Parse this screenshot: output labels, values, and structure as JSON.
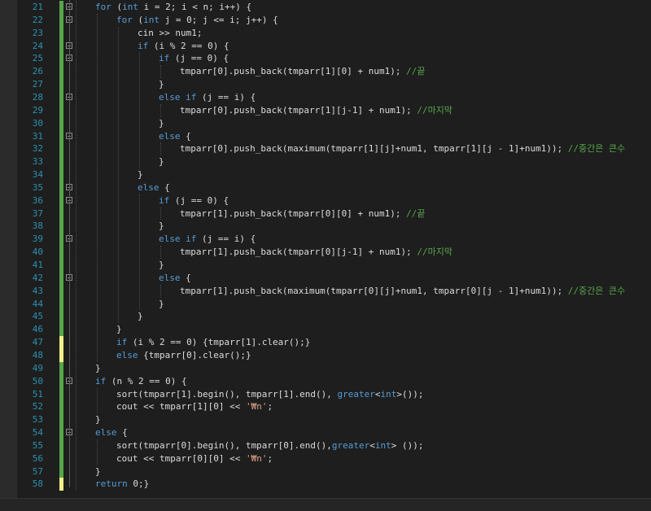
{
  "colors": {
    "background": "#1e1e1e",
    "line_number": "#2b91af",
    "keyword": "#569cd6",
    "comment": "#57a64a",
    "string": "#d69d85",
    "text": "#dcdcdc",
    "saved_change": "#57a64a",
    "unsaved_change": "#efef88"
  },
  "lines": [
    {
      "n": "21",
      "change": "saved",
      "fold": true,
      "indent": 1,
      "tokens": [
        {
          "t": "kw",
          "s": "for"
        },
        {
          "t": "tx",
          "s": " ("
        },
        {
          "t": "kw",
          "s": "int"
        },
        {
          "t": "tx",
          "s": " i = 2; i < n; i++) {"
        }
      ]
    },
    {
      "n": "22",
      "change": "saved",
      "fold": true,
      "indent": 2,
      "tokens": [
        {
          "t": "kw",
          "s": "for"
        },
        {
          "t": "tx",
          "s": " ("
        },
        {
          "t": "kw",
          "s": "int"
        },
        {
          "t": "tx",
          "s": " j = 0; j <= i; j++) {"
        }
      ]
    },
    {
      "n": "23",
      "change": "saved",
      "fold": false,
      "indent": 3,
      "tokens": [
        {
          "t": "tx",
          "s": "cin >> num1;"
        }
      ]
    },
    {
      "n": "24",
      "change": "saved",
      "fold": true,
      "indent": 3,
      "tokens": [
        {
          "t": "kw",
          "s": "if"
        },
        {
          "t": "tx",
          "s": " (i % 2 == 0) {"
        }
      ]
    },
    {
      "n": "25",
      "change": "saved",
      "fold": true,
      "indent": 4,
      "tokens": [
        {
          "t": "kw",
          "s": "if"
        },
        {
          "t": "tx",
          "s": " (j == 0) {"
        }
      ]
    },
    {
      "n": "26",
      "change": "saved",
      "fold": false,
      "indent": 5,
      "tokens": [
        {
          "t": "tx",
          "s": "tmparr[0].push_back(tmparr[1][0] + num1); "
        },
        {
          "t": "cm",
          "s": "//끝"
        }
      ]
    },
    {
      "n": "27",
      "change": "saved",
      "fold": false,
      "indent": 4,
      "tokens": [
        {
          "t": "tx",
          "s": "}"
        }
      ]
    },
    {
      "n": "28",
      "change": "saved",
      "fold": true,
      "indent": 4,
      "tokens": [
        {
          "t": "kw",
          "s": "else"
        },
        {
          "t": "tx",
          "s": " "
        },
        {
          "t": "kw",
          "s": "if"
        },
        {
          "t": "tx",
          "s": " (j == i) {"
        }
      ]
    },
    {
      "n": "29",
      "change": "saved",
      "fold": false,
      "indent": 5,
      "tokens": [
        {
          "t": "tx",
          "s": "tmparr[0].push_back(tmparr[1][j-1] + num1); "
        },
        {
          "t": "cm",
          "s": "//마지막"
        }
      ]
    },
    {
      "n": "30",
      "change": "saved",
      "fold": false,
      "indent": 4,
      "tokens": [
        {
          "t": "tx",
          "s": "}"
        }
      ]
    },
    {
      "n": "31",
      "change": "saved",
      "fold": true,
      "indent": 4,
      "tokens": [
        {
          "t": "kw",
          "s": "else"
        },
        {
          "t": "tx",
          "s": " {"
        }
      ]
    },
    {
      "n": "32",
      "change": "saved",
      "fold": false,
      "indent": 5,
      "tokens": [
        {
          "t": "tx",
          "s": "tmparr[0].push_back(maximum(tmparr[1][j]+num1, tmparr[1][j - 1]+num1)); "
        },
        {
          "t": "cm",
          "s": "//중간은 큰수"
        }
      ]
    },
    {
      "n": "33",
      "change": "saved",
      "fold": false,
      "indent": 4,
      "tokens": [
        {
          "t": "tx",
          "s": "}"
        }
      ]
    },
    {
      "n": "34",
      "change": "saved",
      "fold": false,
      "indent": 3,
      "tokens": [
        {
          "t": "tx",
          "s": "}"
        }
      ]
    },
    {
      "n": "35",
      "change": "saved",
      "fold": true,
      "indent": 3,
      "tokens": [
        {
          "t": "kw",
          "s": "else"
        },
        {
          "t": "tx",
          "s": " {"
        }
      ]
    },
    {
      "n": "36",
      "change": "saved",
      "fold": true,
      "indent": 4,
      "tokens": [
        {
          "t": "kw",
          "s": "if"
        },
        {
          "t": "tx",
          "s": " (j == 0) {"
        }
      ]
    },
    {
      "n": "37",
      "change": "saved",
      "fold": false,
      "indent": 5,
      "tokens": [
        {
          "t": "tx",
          "s": "tmparr[1].push_back(tmparr[0][0] + num1); "
        },
        {
          "t": "cm",
          "s": "//끝"
        }
      ]
    },
    {
      "n": "38",
      "change": "saved",
      "fold": false,
      "indent": 4,
      "tokens": [
        {
          "t": "tx",
          "s": "}"
        }
      ]
    },
    {
      "n": "39",
      "change": "saved",
      "fold": true,
      "indent": 4,
      "tokens": [
        {
          "t": "kw",
          "s": "else"
        },
        {
          "t": "tx",
          "s": " "
        },
        {
          "t": "kw",
          "s": "if"
        },
        {
          "t": "tx",
          "s": " (j == i) {"
        }
      ]
    },
    {
      "n": "40",
      "change": "saved",
      "fold": false,
      "indent": 5,
      "tokens": [
        {
          "t": "tx",
          "s": "tmparr[1].push_back(tmparr[0][j-1] + num1); "
        },
        {
          "t": "cm",
          "s": "//마지막"
        }
      ]
    },
    {
      "n": "41",
      "change": "saved",
      "fold": false,
      "indent": 4,
      "tokens": [
        {
          "t": "tx",
          "s": "}"
        }
      ]
    },
    {
      "n": "42",
      "change": "saved",
      "fold": true,
      "indent": 4,
      "tokens": [
        {
          "t": "kw",
          "s": "else"
        },
        {
          "t": "tx",
          "s": " {"
        }
      ]
    },
    {
      "n": "43",
      "change": "saved",
      "fold": false,
      "indent": 5,
      "tokens": [
        {
          "t": "tx",
          "s": "tmparr[1].push_back(maximum(tmparr[0][j]+num1, tmparr[0][j - 1]+num1)); "
        },
        {
          "t": "cm",
          "s": "//중간은 큰수"
        }
      ]
    },
    {
      "n": "44",
      "change": "saved",
      "fold": false,
      "indent": 4,
      "tokens": [
        {
          "t": "tx",
          "s": "}"
        }
      ]
    },
    {
      "n": "45",
      "change": "saved",
      "fold": false,
      "indent": 3,
      "tokens": [
        {
          "t": "tx",
          "s": "}"
        }
      ]
    },
    {
      "n": "46",
      "change": "saved",
      "fold": false,
      "indent": 2,
      "tokens": [
        {
          "t": "tx",
          "s": "}"
        }
      ]
    },
    {
      "n": "47",
      "change": "unsaved",
      "fold": false,
      "indent": 2,
      "tokens": [
        {
          "t": "kw",
          "s": "if"
        },
        {
          "t": "tx",
          "s": " (i % 2 == 0) {tmparr[1].clear();}"
        }
      ]
    },
    {
      "n": "48",
      "change": "unsaved",
      "fold": false,
      "indent": 2,
      "tokens": [
        {
          "t": "kw",
          "s": "else"
        },
        {
          "t": "tx",
          "s": " {tmparr[0].clear();}"
        }
      ]
    },
    {
      "n": "49",
      "change": "saved",
      "fold": false,
      "indent": 1,
      "tokens": [
        {
          "t": "tx",
          "s": "}"
        }
      ]
    },
    {
      "n": "50",
      "change": "saved",
      "fold": true,
      "indent": 1,
      "tokens": [
        {
          "t": "kw",
          "s": "if"
        },
        {
          "t": "tx",
          "s": " (n % 2 == 0) {"
        }
      ]
    },
    {
      "n": "51",
      "change": "saved",
      "fold": false,
      "indent": 2,
      "tokens": [
        {
          "t": "tx",
          "s": "sort(tmparr[1].begin(), tmparr[1].end(), "
        },
        {
          "t": "kw",
          "s": "greater"
        },
        {
          "t": "tx",
          "s": "<"
        },
        {
          "t": "kw",
          "s": "int"
        },
        {
          "t": "tx",
          "s": ">());"
        }
      ]
    },
    {
      "n": "52",
      "change": "saved",
      "fold": false,
      "indent": 2,
      "tokens": [
        {
          "t": "tx",
          "s": "cout << tmparr[1][0] << "
        },
        {
          "t": "str",
          "s": "'₩n'"
        },
        {
          "t": "tx",
          "s": ";"
        }
      ]
    },
    {
      "n": "53",
      "change": "saved",
      "fold": false,
      "indent": 1,
      "tokens": [
        {
          "t": "tx",
          "s": "}"
        }
      ]
    },
    {
      "n": "54",
      "change": "saved",
      "fold": true,
      "indent": 1,
      "tokens": [
        {
          "t": "kw",
          "s": "else"
        },
        {
          "t": "tx",
          "s": " {"
        }
      ]
    },
    {
      "n": "55",
      "change": "saved",
      "fold": false,
      "indent": 2,
      "tokens": [
        {
          "t": "tx",
          "s": "sort(tmparr[0].begin(), tmparr[0].end(),"
        },
        {
          "t": "kw",
          "s": "greater"
        },
        {
          "t": "tx",
          "s": "<"
        },
        {
          "t": "kw",
          "s": "int"
        },
        {
          "t": "tx",
          "s": "> ());"
        }
      ]
    },
    {
      "n": "56",
      "change": "saved",
      "fold": false,
      "indent": 2,
      "tokens": [
        {
          "t": "tx",
          "s": "cout << tmparr[0][0] << "
        },
        {
          "t": "str",
          "s": "'₩n'"
        },
        {
          "t": "tx",
          "s": ";"
        }
      ]
    },
    {
      "n": "57",
      "change": "saved",
      "fold": false,
      "indent": 1,
      "tokens": [
        {
          "t": "tx",
          "s": "}"
        }
      ]
    },
    {
      "n": "58",
      "change": "unsaved",
      "fold": false,
      "indent": 1,
      "tokens": [
        {
          "t": "kw",
          "s": "return"
        },
        {
          "t": "tx",
          "s": " 0;}"
        }
      ]
    }
  ]
}
